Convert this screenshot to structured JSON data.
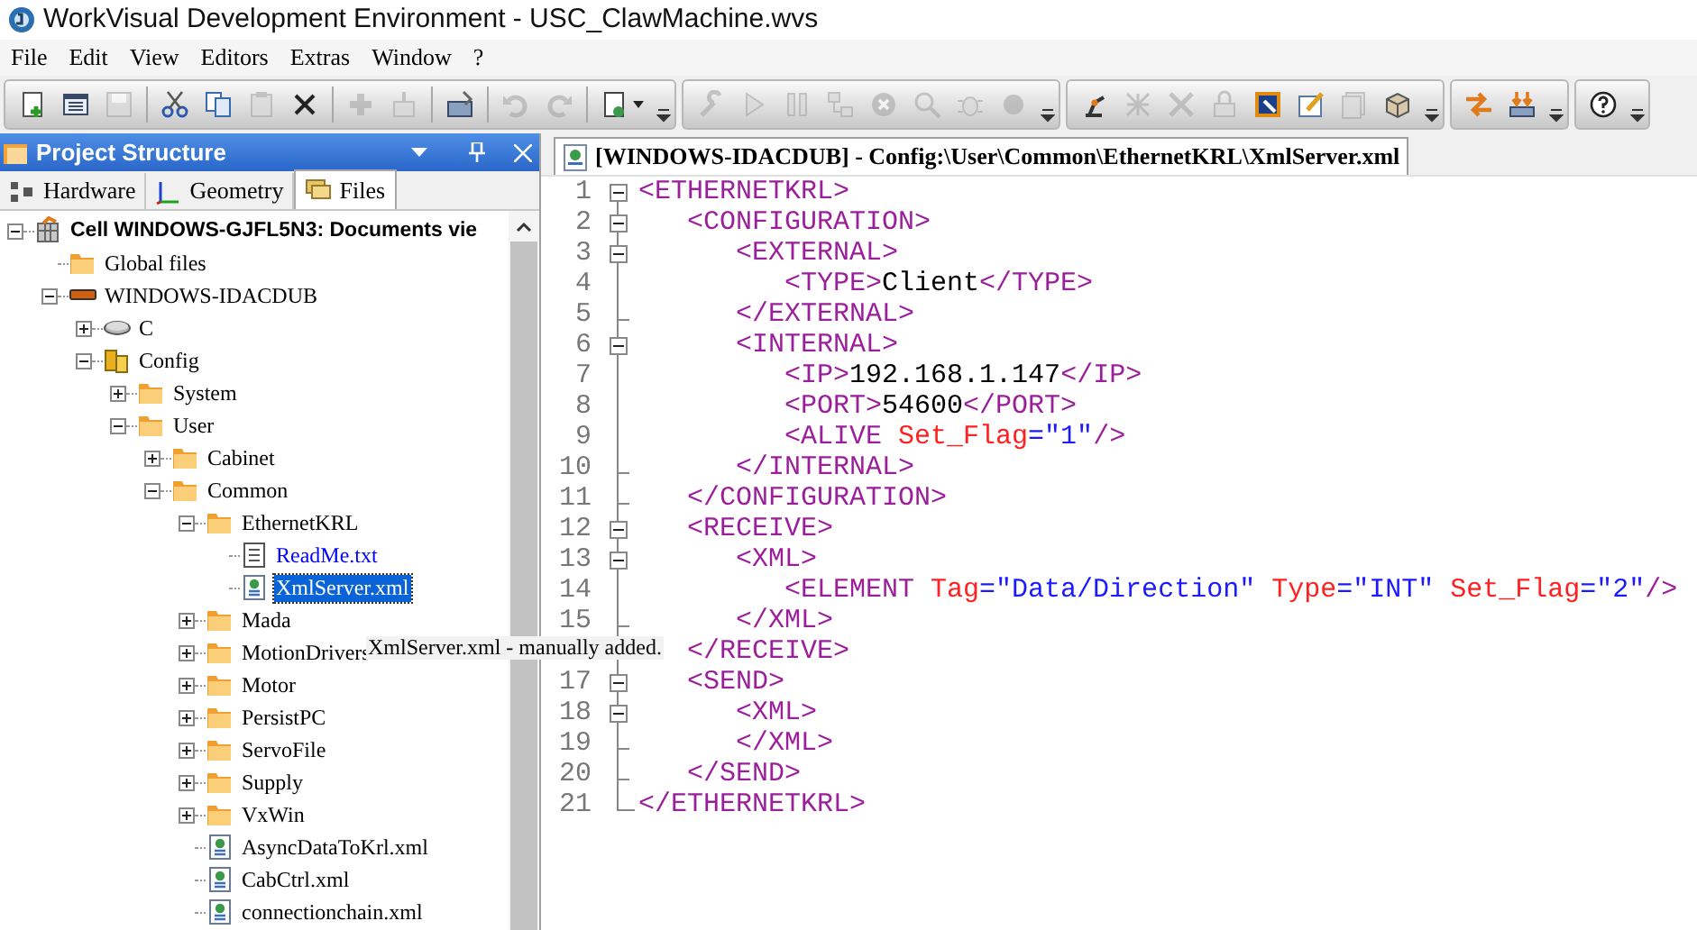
{
  "window": {
    "title": "WorkVisual Development Environment - USC_ClawMachine.wvs"
  },
  "menu": [
    "File",
    "Edit",
    "View",
    "Editors",
    "Extras",
    "Window",
    "?"
  ],
  "toolbar": [
    [
      {
        "kind": "new",
        "disabled": false
      },
      {
        "kind": "properties",
        "disabled": false
      },
      {
        "kind": "save",
        "disabled": true
      },
      {
        "kind": "sep"
      },
      {
        "kind": "cut",
        "disabled": false
      },
      {
        "kind": "copy",
        "disabled": false
      },
      {
        "kind": "paste",
        "disabled": true
      },
      {
        "kind": "delete",
        "disabled": false
      },
      {
        "kind": "sep"
      },
      {
        "kind": "add",
        "disabled": true
      },
      {
        "kind": "insert",
        "disabled": true
      },
      {
        "kind": "sep"
      },
      {
        "kind": "toolbox",
        "disabled": false
      },
      {
        "kind": "sep"
      },
      {
        "kind": "undo",
        "disabled": true
      },
      {
        "kind": "redo",
        "disabled": true
      },
      {
        "kind": "sep"
      },
      {
        "kind": "document",
        "disabled": false
      }
    ],
    [
      {
        "kind": "wrench",
        "disabled": true
      },
      {
        "kind": "play",
        "disabled": true
      },
      {
        "kind": "pause",
        "disabled": true
      },
      {
        "kind": "network",
        "disabled": true
      },
      {
        "kind": "stop",
        "disabled": true
      },
      {
        "kind": "search",
        "disabled": true
      },
      {
        "kind": "bug",
        "disabled": true
      },
      {
        "kind": "record",
        "disabled": true
      }
    ],
    [
      {
        "kind": "robot",
        "disabled": false
      },
      {
        "kind": "grid",
        "disabled": true
      },
      {
        "kind": "tools",
        "disabled": true
      },
      {
        "kind": "lock",
        "disabled": true
      },
      {
        "kind": "inspect",
        "disabled": false
      },
      {
        "kind": "edit",
        "disabled": false
      },
      {
        "kind": "notes",
        "disabled": true
      },
      {
        "kind": "package",
        "disabled": false
      }
    ],
    [
      {
        "kind": "transfer",
        "disabled": false
      },
      {
        "kind": "download",
        "disabled": false
      }
    ],
    [
      {
        "kind": "help",
        "disabled": false
      }
    ]
  ],
  "panel": {
    "title": "Project Structure",
    "tabs": [
      {
        "label": "Hardware",
        "kind": "hardware",
        "selected": false
      },
      {
        "label": "Geometry",
        "kind": "geometry",
        "selected": false
      },
      {
        "label": "Files",
        "kind": "files",
        "selected": true
      }
    ],
    "tree": [
      {
        "label": "Cell WINDOWS-GJFL5N3: Documents vie",
        "kind": "cell",
        "expanded": true,
        "selected": false,
        "children": [
          {
            "label": "Global files",
            "kind": "folder",
            "selected": false
          },
          {
            "label": "WINDOWS-IDACDUB",
            "kind": "device",
            "expanded": true,
            "selected": false,
            "children": [
              {
                "label": "C",
                "kind": "drive",
                "expanded": false,
                "selected": false
              },
              {
                "label": "Config",
                "kind": "config",
                "expanded": true,
                "selected": false,
                "children": [
                  {
                    "label": "System",
                    "kind": "folder",
                    "expanded": false,
                    "selected": false
                  },
                  {
                    "label": "User",
                    "kind": "folder",
                    "expanded": true,
                    "selected": false,
                    "children": [
                      {
                        "label": "Cabinet",
                        "kind": "folder",
                        "expanded": false,
                        "selected": false
                      },
                      {
                        "label": "Common",
                        "kind": "folder",
                        "expanded": true,
                        "selected": false,
                        "children": [
                          {
                            "label": "EthernetKRL",
                            "kind": "folder",
                            "expanded": true,
                            "selected": false,
                            "children": [
                              {
                                "label": "ReadMe.txt",
                                "kind": "txt",
                                "color": "#0000ff",
                                "selected": false
                              },
                              {
                                "label": "XmlServer.xml",
                                "kind": "xml",
                                "selected": true
                              }
                            ]
                          },
                          {
                            "label": "Mada",
                            "kind": "folder",
                            "expanded": false,
                            "selected": false
                          },
                          {
                            "label": "MotionDrivers",
                            "kind": "folder",
                            "expanded": false,
                            "selected": false
                          },
                          {
                            "label": "Motor",
                            "kind": "folder",
                            "expanded": false,
                            "selected": false
                          },
                          {
                            "label": "PersistPC",
                            "kind": "folder",
                            "expanded": false,
                            "selected": false
                          },
                          {
                            "label": "ServoFile",
                            "kind": "folder",
                            "expanded": false,
                            "selected": false
                          },
                          {
                            "label": "Supply",
                            "kind": "folder",
                            "expanded": false,
                            "selected": false
                          },
                          {
                            "label": "VxWin",
                            "kind": "folder",
                            "expanded": false,
                            "selected": false
                          },
                          {
                            "label": "AsyncDataToKrl.xml",
                            "kind": "xml",
                            "selected": false
                          },
                          {
                            "label": "CabCtrl.xml",
                            "kind": "xml",
                            "selected": false
                          },
                          {
                            "label": "connectionchain.xml",
                            "kind": "xml",
                            "selected": false
                          }
                        ]
                      }
                    ]
                  }
                ]
              }
            ]
          }
        ]
      }
    ]
  },
  "tooltip": "XmlServer.xml - manually added.",
  "editor": {
    "tab": "[WINDOWS-IDACDUB] - Config:\\User\\Common\\EthernetKRL\\XmlServer.xml",
    "lines": [
      {
        "number": "1",
        "kind": "start",
        "segments": [
          {
            "kind": "tag",
            "text": "<ETHERNETKRL>"
          }
        ]
      },
      {
        "number": "2",
        "kind": "start",
        "segments": [
          {
            "kind": "tag",
            "text": "   <CONFIGURATION>"
          }
        ]
      },
      {
        "number": "3",
        "kind": "start",
        "segments": [
          {
            "kind": "tag",
            "text": "      <EXTERNAL>"
          }
        ]
      },
      {
        "number": "4",
        "kind": "mid",
        "segments": [
          {
            "kind": "tag",
            "text": "         <TYPE>"
          },
          {
            "kind": "text",
            "text": "Client"
          },
          {
            "kind": "tag",
            "text": "</TYPE>"
          }
        ]
      },
      {
        "number": "5",
        "kind": "end",
        "segments": [
          {
            "kind": "tag",
            "text": "      </EXTERNAL>"
          }
        ]
      },
      {
        "number": "6",
        "kind": "start",
        "segments": [
          {
            "kind": "tag",
            "text": "      <INTERNAL>"
          }
        ]
      },
      {
        "number": "7",
        "kind": "mid",
        "segments": [
          {
            "kind": "tag",
            "text": "         <IP>"
          },
          {
            "kind": "text",
            "text": "192.168.1.147"
          },
          {
            "kind": "tag",
            "text": "</IP>"
          }
        ]
      },
      {
        "number": "8",
        "kind": "mid",
        "segments": [
          {
            "kind": "tag",
            "text": "         <PORT>"
          },
          {
            "kind": "text",
            "text": "54600"
          },
          {
            "kind": "tag",
            "text": "</PORT>"
          }
        ]
      },
      {
        "number": "9",
        "kind": "mid",
        "segments": [
          {
            "kind": "tag",
            "text": "         <ALIVE "
          },
          {
            "kind": "attr",
            "text": "Set_Flag"
          },
          {
            "kind": "value",
            "text": "=\"1\""
          },
          {
            "kind": "tag",
            "text": "/>"
          }
        ]
      },
      {
        "number": "10",
        "kind": "end",
        "segments": [
          {
            "kind": "tag",
            "text": "      </INTERNAL>"
          }
        ]
      },
      {
        "number": "11",
        "kind": "end",
        "segments": [
          {
            "kind": "tag",
            "text": "   </CONFIGURATION>"
          }
        ]
      },
      {
        "number": "12",
        "kind": "start",
        "segments": [
          {
            "kind": "tag",
            "text": "   <RECEIVE>"
          }
        ]
      },
      {
        "number": "13",
        "kind": "start",
        "segments": [
          {
            "kind": "tag",
            "text": "      <XML>"
          }
        ]
      },
      {
        "number": "14",
        "kind": "mid",
        "segments": [
          {
            "kind": "tag",
            "text": "         <ELEMENT "
          },
          {
            "kind": "attr",
            "text": "Tag"
          },
          {
            "kind": "value",
            "text": "=\"Data/Direction\" "
          },
          {
            "kind": "attr",
            "text": "Type"
          },
          {
            "kind": "value",
            "text": "=\"INT\" "
          },
          {
            "kind": "attr",
            "text": "Set_Flag"
          },
          {
            "kind": "value",
            "text": "=\"2\""
          },
          {
            "kind": "tag",
            "text": "/>"
          }
        ]
      },
      {
        "number": "15",
        "kind": "end",
        "segments": [
          {
            "kind": "tag",
            "text": "      </XML>"
          }
        ]
      },
      {
        "kind": "end",
        "segments": [
          {
            "kind": "tag",
            "text": "   </RECEIVE>"
          }
        ]
      },
      {
        "number": "17",
        "kind": "start",
        "segments": [
          {
            "kind": "tag",
            "text": "   <SEND>"
          }
        ]
      },
      {
        "number": "18",
        "kind": "start",
        "segments": [
          {
            "kind": "tag",
            "text": "      <XML>"
          }
        ]
      },
      {
        "number": "19",
        "kind": "end",
        "segments": [
          {
            "kind": "tag",
            "text": "      </XML>"
          }
        ]
      },
      {
        "number": "20",
        "kind": "end",
        "segments": [
          {
            "kind": "tag",
            "text": "   </SEND>"
          }
        ]
      },
      {
        "number": "21",
        "kind": "last",
        "segments": [
          {
            "kind": "tag",
            "text": "</ETHERNETKRL>"
          }
        ]
      }
    ]
  }
}
